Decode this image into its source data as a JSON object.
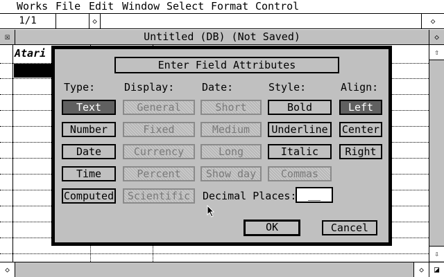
{
  "menu": [
    "Works",
    "File",
    "Edit",
    "Window",
    "Select",
    "Format",
    "Control"
  ],
  "entry_bar": {
    "cell_ref": "1/1",
    "left_arrow": "◇",
    "right_arrow": "◇"
  },
  "window": {
    "title": "Untitled (DB) (Not Saved)",
    "close_glyph": "☒",
    "fuller_glyph": "◇"
  },
  "sheet": {
    "column_label": "Atari"
  },
  "scrollbars": {
    "up": "⇧",
    "down": "⇩",
    "left": "◇",
    "right": "◇",
    "size": "◪"
  },
  "dialog": {
    "title": "Enter Field Attributes",
    "headers": {
      "type": "Type:",
      "display": "Display:",
      "date": "Date:",
      "style": "Style:",
      "align": "Align:"
    },
    "type_options": [
      "Text",
      "Number",
      "Date",
      "Time",
      "Computed"
    ],
    "display_options": [
      "General",
      "Fixed",
      "Currency",
      "Percent",
      "Scientific"
    ],
    "date_options": [
      "Short",
      "Medium",
      "Long",
      "Show day"
    ],
    "style_options": [
      "Bold",
      "Underline",
      "Italic",
      "Commas"
    ],
    "align_options": [
      "Left",
      "Center",
      "Right"
    ],
    "decimal_label": "Decimal Places:",
    "decimal_value": "__",
    "ok_label": "OK",
    "cancel_label": "Cancel",
    "selected_type": "Text",
    "selected_align": "Left"
  },
  "colors": {
    "desktop_gray": "#c0c0c0",
    "selected_button": "#606060",
    "disabled_text": "#7a7a7a"
  }
}
